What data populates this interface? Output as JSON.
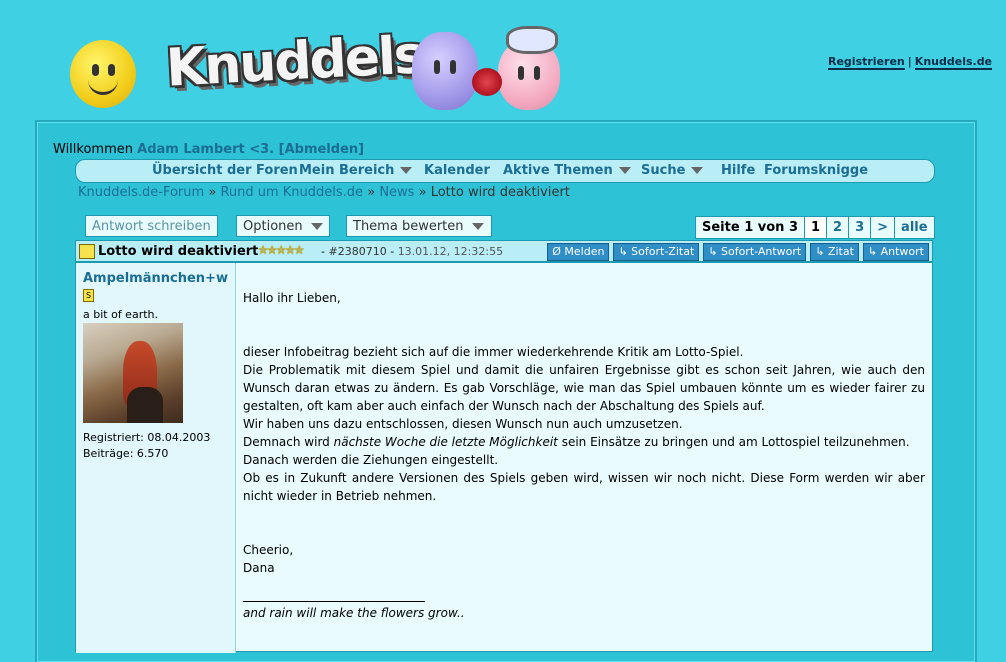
{
  "header": {
    "logo_text": "Knuddels",
    "links": {
      "register": "Registrieren",
      "separator": "|",
      "site": "Knuddels.de"
    }
  },
  "welcome": {
    "prefix": "Willkommen",
    "username": "Adam Lambert <3.",
    "logout": "[Abmelden]"
  },
  "nav": {
    "items": [
      {
        "label": "Übersicht der Foren",
        "dropdown": false
      },
      {
        "label": "Mein Bereich",
        "dropdown": true
      },
      {
        "label": "Kalender",
        "dropdown": false
      },
      {
        "label": "Aktive Themen",
        "dropdown": true
      },
      {
        "label": "Suche",
        "dropdown": true
      },
      {
        "label": "Hilfe",
        "dropdown": false
      },
      {
        "label": "Forumsknigge",
        "dropdown": false
      }
    ]
  },
  "breadcrumb": {
    "items": [
      "Knuddels.de-Forum",
      "Rund um Knuddels.de",
      "News"
    ],
    "separator": "»",
    "current": "Lotto wird deaktiviert"
  },
  "toolbar": {
    "reply": "Antwort schreiben",
    "options": "Optionen",
    "rate": "Thema bewerten"
  },
  "pager": {
    "label": "Seite 1 von 3",
    "pages": [
      "1",
      "2",
      "3"
    ],
    "current": "1",
    "next": ">",
    "all": "alle"
  },
  "post": {
    "title": "Lotto wird deaktiviert",
    "stars": "✮✮✮✮✮",
    "rating": 5,
    "dash": "-",
    "number": "#2380710",
    "date": "13.01.12, 12:32:55",
    "actions": [
      "Ø Melden",
      "↳ Sofort-Zitat",
      "↳ Sofort-Antwort",
      "↳ Zitat",
      "↳ Antwort"
    ],
    "author": {
      "name": "Ampelmännchen+w",
      "badge": "S",
      "motto": "a bit of earth.",
      "registered": "Registriert: 08.04.2003",
      "posts": "Beiträge: 6.570"
    },
    "body": {
      "greeting": "Hallo ihr Lieben,",
      "p1": "dieser Infobeitrag bezieht sich auf die immer wiederkehrende Kritik am Lotto-Spiel.",
      "p2": "Die Problematik mit diesem Spiel und damit die unfairen Ergebnisse gibt es schon seit Jahren, wie auch den Wunsch daran etwas zu ändern. Es gab Vorschläge, wie man das Spiel umbauen könnte um es wieder fairer zu gestalten, oft kam aber auch einfach der Wunsch nach der Abschaltung des Spiels auf.",
      "p3": "Wir haben uns dazu entschlossen, diesen Wunsch nun auch umzusetzen.",
      "p4_before": "Demnach wird",
      "p4_italic": "nächste Woche die letzte Möglichkeit",
      "p4_after": "sein Einsätze zu bringen und am Lottospiel teilzunehmen.",
      "p5": "Danach werden die Ziehungen eingestellt.",
      "p6": "Ob es in Zukunft andere Versionen des Spiels geben wird, wissen wir noch nicht. Diese Form werden wir aber nicht wieder in Betrieb nehmen.",
      "closing": "Cheerio,",
      "name": "Dana",
      "signature": "and rain will make the flowers grow.."
    }
  }
}
